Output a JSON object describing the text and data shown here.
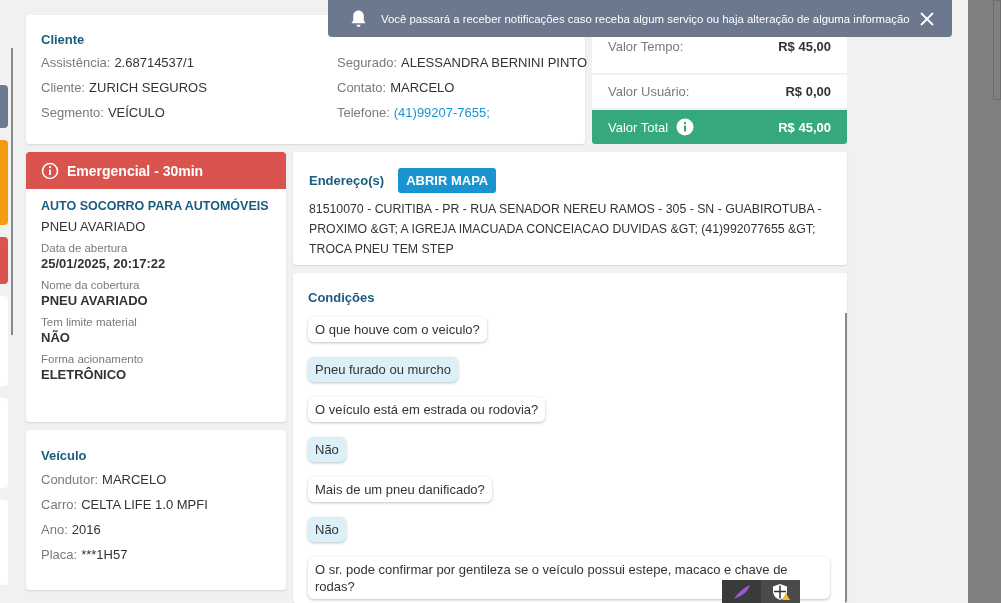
{
  "side_tabs": [
    {
      "color": "#6b7a90"
    },
    {
      "color": "#f39c12"
    },
    {
      "color": "#d9534f"
    },
    {
      "color": "#ffffff"
    },
    {
      "color": "#ffffff"
    },
    {
      "color": "#ffffff"
    }
  ],
  "notification": {
    "text": "Você passará a receber notificações caso receba algum serviço ou haja alteração de alguma informação"
  },
  "cliente": {
    "title": "Cliente",
    "fields": [
      {
        "label": "Assistência:",
        "value": "2.68714537/1"
      },
      {
        "label": "Segurado:",
        "value": "ALESSANDRA BERNINI PINTO"
      },
      {
        "label": "Cliente:",
        "value": "ZURICH SEGUROS"
      },
      {
        "label": "Contato:",
        "value": "MARCELO"
      },
      {
        "label": "Segmento:",
        "value": "VEÍCULO"
      },
      {
        "label": "Telefone:",
        "value": "(41)99207-7655;",
        "kind": "link"
      }
    ]
  },
  "valores": [
    {
      "label": "Valor Tempo:",
      "value": "R$ 45,00",
      "kind": "plain"
    },
    {
      "label": "Valor Usuário:",
      "value": "R$ 0,00",
      "kind": "plain"
    },
    {
      "label": "Valor Total",
      "value": "R$ 45,00",
      "kind": "total"
    }
  ],
  "servico": {
    "priority": "Emergencial - 30min",
    "title": "AUTO SOCORRO PARA AUTOMÓVEIS",
    "subtitle": "PNEU AVARIADO",
    "details": [
      {
        "label": "Data de abertura",
        "value": "25/01/2025, 20:17:22"
      },
      {
        "label": "Nome da cobertura",
        "value": "PNEU AVARIADO"
      },
      {
        "label": "Tem limite material",
        "value": "NÃO"
      },
      {
        "label": "Forma acionamento",
        "value": "ELETRÔNICO"
      }
    ]
  },
  "veiculo": {
    "title": "Veículo",
    "fields": [
      {
        "label": "Condutor:",
        "value": "MARCELO"
      },
      {
        "label": "Carro:",
        "value": "CELTA LIFE 1.0 MPFI"
      },
      {
        "label": "Ano:",
        "value": "2016"
      },
      {
        "label": "Placa:",
        "value": "***1H57"
      }
    ]
  },
  "endereco": {
    "title": "Endereço(s)",
    "button": "ABRIR MAPA",
    "text": "81510070 - CURITIBA - PR - RUA SENADOR NEREU RAMOS - 305 - SN - GUABIROTUBA - PROXIMO &GT; A IGREJA IMACUADA CONCEIACAO DUVIDAS &GT; (41)992077655 &GT; TROCA PNEU TEM STEP"
  },
  "condicoes": {
    "title": "Condições",
    "items": [
      {
        "kind": "question",
        "text": "O que houve com o veiculo?"
      },
      {
        "kind": "answer",
        "text": "Pneu furado ou murcho"
      },
      {
        "kind": "question",
        "text": "O veículo está em estrada ou rodovia?"
      },
      {
        "kind": "answer",
        "text": "Não"
      },
      {
        "kind": "question",
        "text": "Mais de um pneu danificado?"
      },
      {
        "kind": "answer",
        "text": "Não"
      },
      {
        "kind": "question",
        "text": "O sr. pode confirmar por gentileza se o veículo possui estepe, macaco e chave de rodas?"
      }
    ]
  }
}
